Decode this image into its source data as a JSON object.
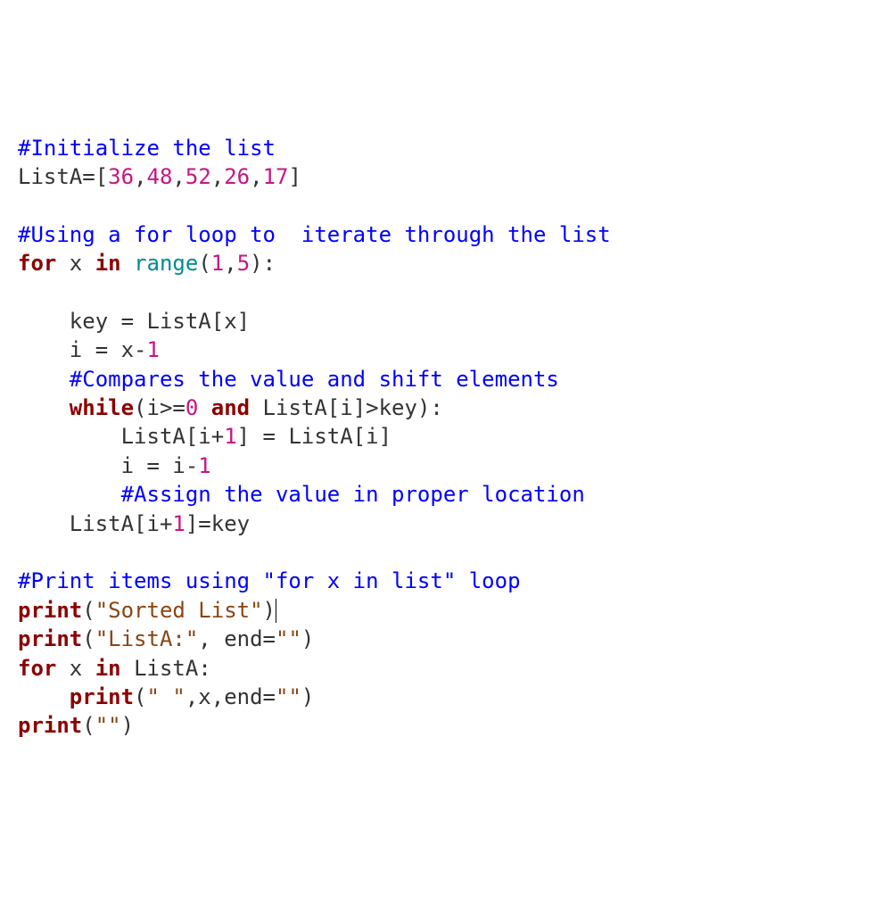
{
  "code": {
    "lines": [
      {
        "segments": [
          {
            "cls": "comment",
            "text": "#Initialize the list"
          }
        ]
      },
      {
        "segments": [
          {
            "cls": "default",
            "text": "ListA=["
          },
          {
            "cls": "number",
            "text": "36"
          },
          {
            "cls": "default",
            "text": ","
          },
          {
            "cls": "number",
            "text": "48"
          },
          {
            "cls": "default",
            "text": ","
          },
          {
            "cls": "number",
            "text": "52"
          },
          {
            "cls": "default",
            "text": ","
          },
          {
            "cls": "number",
            "text": "26"
          },
          {
            "cls": "default",
            "text": ","
          },
          {
            "cls": "number",
            "text": "17"
          },
          {
            "cls": "default",
            "text": "]"
          }
        ]
      },
      {
        "segments": []
      },
      {
        "segments": [
          {
            "cls": "comment",
            "text": "#Using a for loop to  iterate through the list"
          }
        ]
      },
      {
        "segments": [
          {
            "cls": "keyword",
            "text": "for"
          },
          {
            "cls": "default",
            "text": " x "
          },
          {
            "cls": "keyword",
            "text": "in"
          },
          {
            "cls": "default",
            "text": " "
          },
          {
            "cls": "builtin",
            "text": "range"
          },
          {
            "cls": "default",
            "text": "("
          },
          {
            "cls": "number",
            "text": "1"
          },
          {
            "cls": "default",
            "text": ","
          },
          {
            "cls": "number",
            "text": "5"
          },
          {
            "cls": "default",
            "text": "):"
          }
        ]
      },
      {
        "segments": []
      },
      {
        "segments": [
          {
            "cls": "default",
            "text": "    key = ListA[x]"
          }
        ]
      },
      {
        "segments": [
          {
            "cls": "default",
            "text": "    i = x-"
          },
          {
            "cls": "number",
            "text": "1"
          }
        ]
      },
      {
        "segments": [
          {
            "cls": "default",
            "text": "    "
          },
          {
            "cls": "comment",
            "text": "#Compares the value and shift elements"
          }
        ]
      },
      {
        "segments": [
          {
            "cls": "default",
            "text": "    "
          },
          {
            "cls": "keyword",
            "text": "while"
          },
          {
            "cls": "default",
            "text": "(i>="
          },
          {
            "cls": "number",
            "text": "0"
          },
          {
            "cls": "default",
            "text": " "
          },
          {
            "cls": "keyword",
            "text": "and"
          },
          {
            "cls": "default",
            "text": " ListA[i]>key):"
          }
        ]
      },
      {
        "segments": [
          {
            "cls": "default",
            "text": "        ListA[i+"
          },
          {
            "cls": "number",
            "text": "1"
          },
          {
            "cls": "default",
            "text": "] = ListA[i]"
          }
        ]
      },
      {
        "segments": [
          {
            "cls": "default",
            "text": "        i = i-"
          },
          {
            "cls": "number",
            "text": "1"
          }
        ]
      },
      {
        "segments": [
          {
            "cls": "default",
            "text": "        "
          },
          {
            "cls": "comment",
            "text": "#Assign the value in proper location"
          }
        ]
      },
      {
        "segments": [
          {
            "cls": "default",
            "text": "    ListA[i+"
          },
          {
            "cls": "number",
            "text": "1"
          },
          {
            "cls": "default",
            "text": "]=key"
          }
        ]
      },
      {
        "segments": []
      },
      {
        "segments": [
          {
            "cls": "comment",
            "text": "#Print items using \"for x in list\" loop"
          }
        ]
      },
      {
        "segments": [
          {
            "cls": "keyword",
            "text": "print"
          },
          {
            "cls": "default",
            "text": "("
          },
          {
            "cls": "string",
            "text": "\"Sorted List\""
          },
          {
            "cls": "default",
            "text": ")"
          }
        ],
        "cursor_after": true
      },
      {
        "segments": [
          {
            "cls": "keyword",
            "text": "print"
          },
          {
            "cls": "default",
            "text": "("
          },
          {
            "cls": "string",
            "text": "\"ListA:\""
          },
          {
            "cls": "default",
            "text": ", end="
          },
          {
            "cls": "string",
            "text": "\"\""
          },
          {
            "cls": "default",
            "text": ")"
          }
        ]
      },
      {
        "segments": [
          {
            "cls": "keyword",
            "text": "for"
          },
          {
            "cls": "default",
            "text": " x "
          },
          {
            "cls": "keyword",
            "text": "in"
          },
          {
            "cls": "default",
            "text": " ListA:"
          }
        ]
      },
      {
        "segments": [
          {
            "cls": "default",
            "text": "    "
          },
          {
            "cls": "keyword",
            "text": "print"
          },
          {
            "cls": "default",
            "text": "("
          },
          {
            "cls": "string",
            "text": "\" \""
          },
          {
            "cls": "default",
            "text": ",x,end="
          },
          {
            "cls": "string",
            "text": "\"\""
          },
          {
            "cls": "default",
            "text": ")"
          }
        ]
      },
      {
        "segments": [
          {
            "cls": "keyword",
            "text": "print"
          },
          {
            "cls": "default",
            "text": "("
          },
          {
            "cls": "string",
            "text": "\"\""
          },
          {
            "cls": "default",
            "text": ")"
          }
        ]
      }
    ]
  }
}
